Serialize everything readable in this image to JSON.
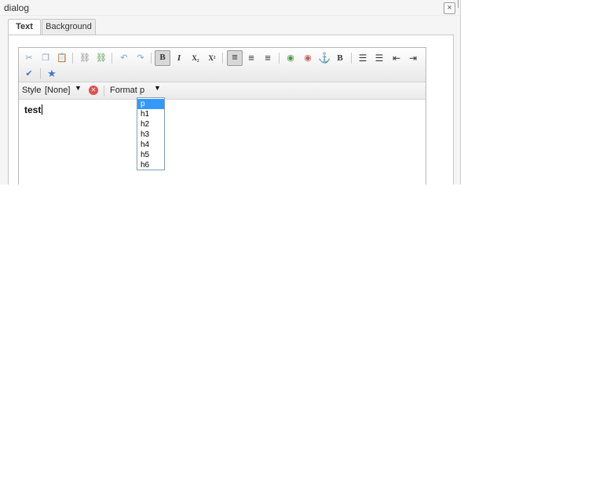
{
  "window": {
    "title": "dialog",
    "close_label": "×"
  },
  "tabs": [
    {
      "label": "Text",
      "active": true
    },
    {
      "label": "Background",
      "active": false
    }
  ],
  "toolbar": {
    "row1": [
      {
        "name": "cut-icon",
        "glyph": "✂"
      },
      {
        "name": "copy-icon",
        "glyph": "❐"
      },
      {
        "name": "paste-icon",
        "glyph": "📋"
      },
      {
        "name": "link-icon",
        "glyph": "⛓"
      },
      {
        "name": "unlink-icon",
        "glyph": "⛓"
      },
      {
        "name": "undo-icon",
        "glyph": "↶"
      },
      {
        "name": "redo-icon",
        "glyph": "↷"
      },
      {
        "name": "bold-icon",
        "glyph": "B"
      },
      {
        "name": "italic-icon",
        "glyph": "I"
      },
      {
        "name": "subscript-icon",
        "glyph": "X₂"
      },
      {
        "name": "superscript-icon",
        "glyph": "X²"
      },
      {
        "name": "align-left-icon",
        "glyph": "≡"
      },
      {
        "name": "align-center-icon",
        "glyph": "≡"
      },
      {
        "name": "align-right-icon",
        "glyph": "≡"
      },
      {
        "name": "globe-icon",
        "glyph": "◉"
      },
      {
        "name": "globe-remove-icon",
        "glyph": "◉"
      },
      {
        "name": "anchor-icon",
        "glyph": "⚓"
      },
      {
        "name": "bold-text-icon",
        "glyph": "B"
      },
      {
        "name": "bullet-list-icon",
        "glyph": "☰"
      },
      {
        "name": "numbered-list-icon",
        "glyph": "☰"
      },
      {
        "name": "outdent-icon",
        "glyph": "⇤"
      },
      {
        "name": "indent-icon",
        "glyph": "⇥"
      }
    ],
    "row2": [
      {
        "name": "spellcheck-icon",
        "glyph": "✔"
      },
      {
        "name": "star-icon",
        "glyph": "★"
      }
    ]
  },
  "style_bar": {
    "style_label": "Style",
    "style_value": "[None]",
    "format_label": "Format",
    "format_value": "p",
    "arrow": "▼",
    "clear_icon": "✕"
  },
  "content": {
    "text": "test"
  },
  "format_options": [
    "p",
    "h1",
    "h2",
    "h3",
    "h4",
    "h5",
    "h6"
  ],
  "selected_format": "p",
  "colors": {
    "selection": "#3399ff",
    "dropdown_border": "#7f9db9",
    "clear": "#e05050"
  }
}
